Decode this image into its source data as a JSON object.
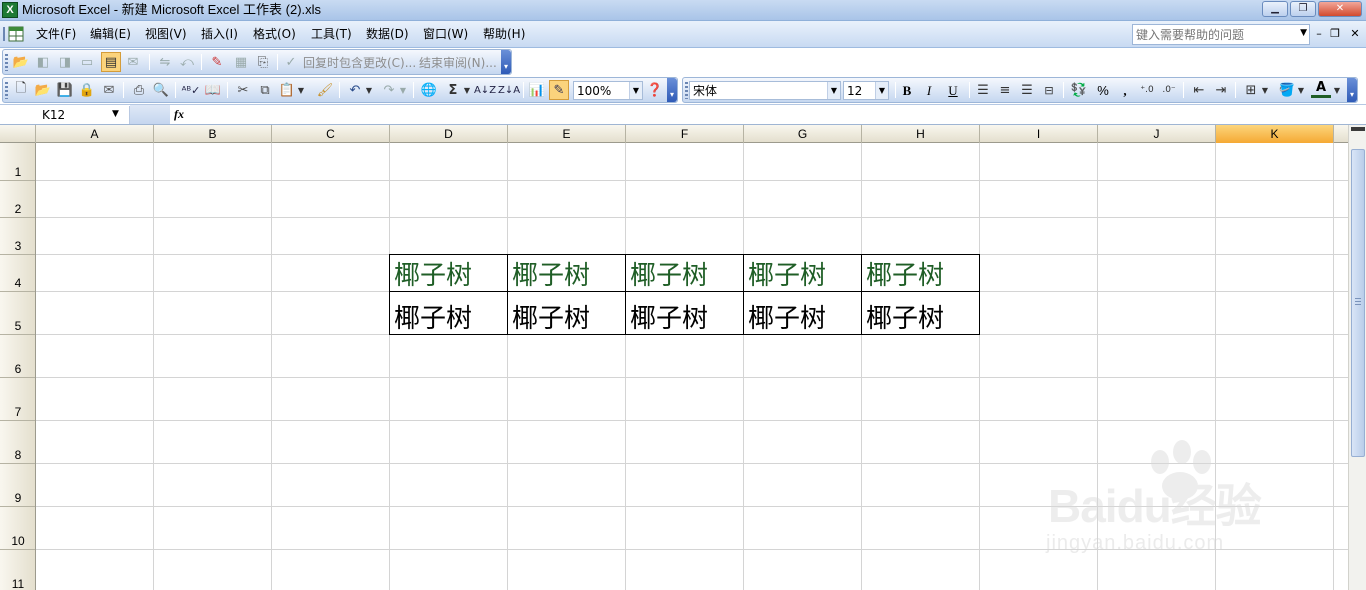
{
  "window": {
    "title": "Microsoft Excel - 新建 Microsoft Excel 工作表 (2).xls",
    "app_icon": "X",
    "controls": [
      "minimize-icon",
      "restore-icon",
      "close-icon"
    ]
  },
  "menu": {
    "items": [
      "文件(F)",
      "编辑(E)",
      "视图(V)",
      "插入(I)",
      "格式(O)",
      "工具(T)",
      "数据(D)",
      "窗口(W)",
      "帮助(H)"
    ],
    "help_placeholder": "键入需要帮助的问题"
  },
  "reviewing_toolbar": {
    "reply_label": "回复时包含更改(C)...",
    "end_review_label": "结束审阅(N)..."
  },
  "standard_toolbar": {
    "zoom": "100%",
    "font_name": "宋体",
    "font_size": "12",
    "bold": "B",
    "italic": "I",
    "underline": "U",
    "percent": "%",
    "comma": ",",
    "autosum": "Σ"
  },
  "formula_bar": {
    "name_box": "K12",
    "fx": "fx",
    "formula": ""
  },
  "sheet": {
    "columns": [
      "A",
      "B",
      "C",
      "D",
      "E",
      "F",
      "G",
      "H",
      "I",
      "J",
      "K"
    ],
    "active_column": "K",
    "rows": [
      "1",
      "2",
      "3",
      "4",
      "5",
      "6",
      "7",
      "8",
      "9",
      "10",
      "11"
    ],
    "row4": [
      "椰子树",
      "椰子树",
      "椰子树",
      "椰子树",
      "椰子树"
    ],
    "row5": [
      "椰子树",
      "椰子树",
      "椰子树",
      "椰子树",
      "椰子树"
    ],
    "row4_color": "#1f5e26",
    "row5_color": "#000000"
  },
  "watermark": {
    "logo": "Baidu经验",
    "url": "jingyan.baidu.com"
  }
}
